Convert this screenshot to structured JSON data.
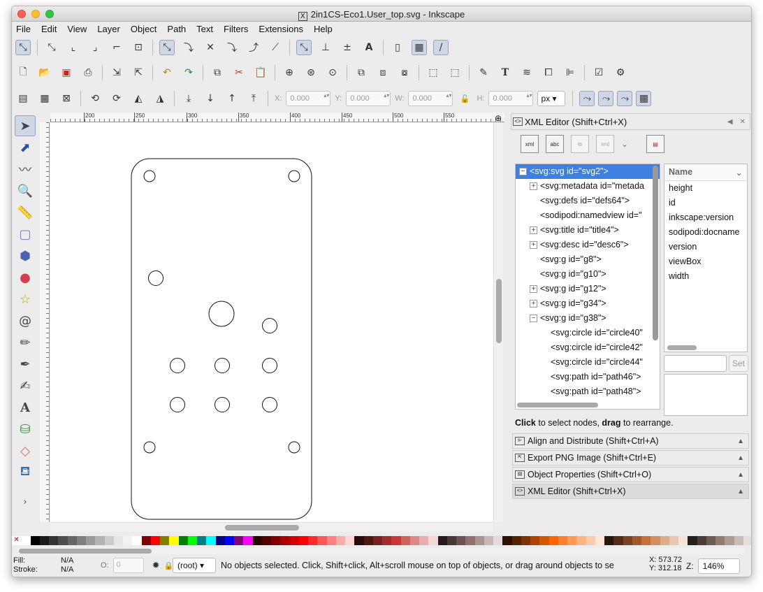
{
  "window": {
    "title": "2in1CS-Eco1.User_top.svg - Inkscape"
  },
  "menu": [
    "File",
    "Edit",
    "View",
    "Layer",
    "Object",
    "Path",
    "Text",
    "Filters",
    "Extensions",
    "Help"
  ],
  "coords": {
    "x_label": "X:",
    "x": "0.000",
    "y_label": "Y:",
    "y": "0.000",
    "w_label": "W:",
    "w": "0.000",
    "h_label": "H:",
    "h": "0.000",
    "unit": "px"
  },
  "ruler": [
    "200",
    "250",
    "300",
    "350",
    "400",
    "450",
    "500",
    "550"
  ],
  "xml_editor": {
    "title": "XML Editor (Shift+Ctrl+X)",
    "tb": [
      "xml",
      "abc",
      "",
      "xml",
      "",
      ""
    ],
    "nodes": [
      {
        "text": "<svg:svg id=\"svg2\">",
        "indent": 0,
        "exp": "−",
        "selected": true
      },
      {
        "text": "<svg:metadata id=\"metada",
        "indent": 1,
        "exp": "+"
      },
      {
        "text": "<svg:defs id=\"defs64\">",
        "indent": 1,
        "exp": ""
      },
      {
        "text": "<sodipodi:namedview id=\"",
        "indent": 1,
        "exp": ""
      },
      {
        "text": "<svg:title id=\"title4\">",
        "indent": 1,
        "exp": "+"
      },
      {
        "text": "<svg:desc id=\"desc6\">",
        "indent": 1,
        "exp": "+"
      },
      {
        "text": "<svg:g id=\"g8\">",
        "indent": 1,
        "exp": ""
      },
      {
        "text": "<svg:g id=\"g10\">",
        "indent": 1,
        "exp": ""
      },
      {
        "text": "<svg:g id=\"g12\">",
        "indent": 1,
        "exp": "+"
      },
      {
        "text": "<svg:g id=\"g34\">",
        "indent": 1,
        "exp": "+"
      },
      {
        "text": "<svg:g id=\"g38\">",
        "indent": 1,
        "exp": "−"
      },
      {
        "text": "<svg:circle id=\"circle40\"",
        "indent": 2,
        "exp": ""
      },
      {
        "text": "<svg:circle id=\"circle42\"",
        "indent": 2,
        "exp": ""
      },
      {
        "text": "<svg:circle id=\"circle44\"",
        "indent": 2,
        "exp": ""
      },
      {
        "text": "<svg:path id=\"path46\">",
        "indent": 2,
        "exp": ""
      },
      {
        "text": "<svg:path id=\"path48\">",
        "indent": 2,
        "exp": ""
      }
    ],
    "attr_header": "Name",
    "attrs": [
      "height",
      "id",
      "inkscape:version",
      "sodipodi:docname",
      "version",
      "viewBox",
      "width"
    ],
    "set_label": "Set",
    "hint_bold1": "Click",
    "hint_mid": " to select nodes, ",
    "hint_bold2": "drag",
    "hint_end": " to rearrange."
  },
  "docked": [
    {
      "label": "Align and Distribute (Shift+Ctrl+A)"
    },
    {
      "label": "Export PNG Image (Shift+Ctrl+E)"
    },
    {
      "label": "Object Properties (Shift+Ctrl+O)"
    },
    {
      "label": "XML Editor (Shift+Ctrl+X)"
    }
  ],
  "status": {
    "fill_label": "Fill:",
    "fill_value": "N/A",
    "stroke_label": "Stroke:",
    "stroke_value": "N/A",
    "opacity_label": "O:",
    "opacity_value": "0",
    "layer": "(root)",
    "message": "No objects selected. Click, Shift+click, Alt+scroll mouse on top of objects, or drag around objects to se",
    "x_label": "X:",
    "x": "573.72",
    "y_label": "Y:",
    "y": "312.18",
    "zoom_label": "Z:",
    "zoom": "146%"
  },
  "colors": {
    "accent": "#3d80df",
    "selection": "#cfd7e6"
  }
}
